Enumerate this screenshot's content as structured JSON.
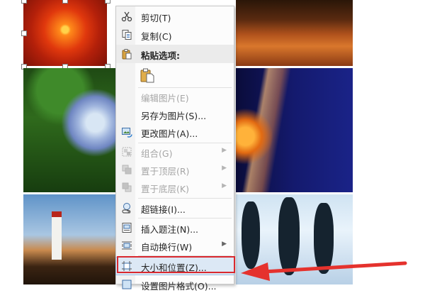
{
  "context_menu": {
    "items": [
      {
        "label": "剪切(T)",
        "icon": "scissors-icon",
        "enabled": true
      },
      {
        "label": "复制(C)",
        "icon": "copy-icon",
        "enabled": true
      },
      {
        "label": "粘贴选项:",
        "icon": "paste-icon",
        "header": true
      },
      {
        "label": "",
        "icon": "paste-picture-icon",
        "enabled": true
      },
      {
        "label": "编辑图片(E)",
        "icon": "",
        "enabled": false
      },
      {
        "label": "另存为图片(S)...",
        "icon": "",
        "enabled": true
      },
      {
        "label": "更改图片(A)...",
        "icon": "change-picture-icon",
        "enabled": true
      },
      {
        "label": "组合(G)",
        "icon": "group-icon",
        "enabled": false,
        "submenu": true
      },
      {
        "label": "置于顶层(R)",
        "icon": "bring-to-front-icon",
        "enabled": false,
        "submenu": true
      },
      {
        "label": "置于底层(K)",
        "icon": "send-to-back-icon",
        "enabled": false,
        "submenu": true
      },
      {
        "label": "超链接(I)...",
        "icon": "hyperlink-icon",
        "enabled": true
      },
      {
        "label": "插入题注(N)...",
        "icon": "insert-caption-icon",
        "enabled": true
      },
      {
        "label": "自动换行(W)",
        "icon": "wrap-text-icon",
        "enabled": true,
        "submenu": true
      },
      {
        "label": "大小和位置(Z)...",
        "icon": "size-position-icon",
        "enabled": true,
        "highlighted": true
      },
      {
        "label": "设置图片格式(O)...",
        "icon": "format-picture-icon",
        "enabled": true
      }
    ]
  },
  "colors": {
    "highlight_box": "#d9282e",
    "arrow": "#e5322d",
    "menu_highlight": "#dce8f5"
  }
}
